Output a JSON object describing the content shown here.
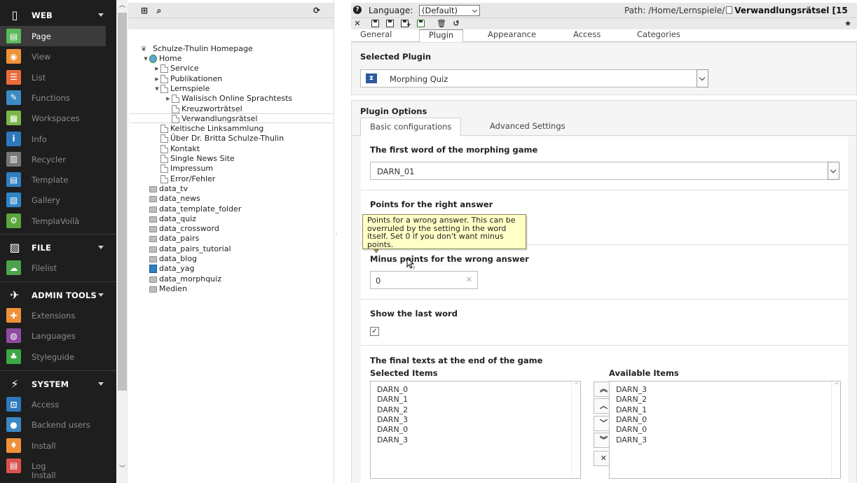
{
  "modules": {
    "groups": [
      {
        "key": "web",
        "label": "WEB",
        "icon": "page-icon"
      },
      {
        "key": "file",
        "label": "FILE",
        "icon": "image-icon"
      },
      {
        "key": "admin",
        "label": "ADMIN TOOLS",
        "icon": "rocket-icon"
      },
      {
        "key": "system",
        "label": "SYSTEM",
        "icon": "plug-icon"
      }
    ],
    "web_items": [
      {
        "label": "Page",
        "color": "#5cb85c",
        "active": true,
        "glyph": "▤"
      },
      {
        "label": "View",
        "color": "#f0913a",
        "glyph": "◉"
      },
      {
        "label": "List",
        "color": "#e96d3c",
        "glyph": "☰"
      },
      {
        "label": "Functions",
        "color": "#3c8bc4",
        "glyph": "✎"
      },
      {
        "label": "Workspaces",
        "color": "#7ab648",
        "glyph": "▦"
      },
      {
        "label": "Info",
        "color": "#2e78be",
        "glyph": "i"
      },
      {
        "label": "Recycler",
        "color": "#777777",
        "glyph": "▥"
      },
      {
        "label": "Template",
        "color": "#2f7fc1",
        "glyph": "▤"
      },
      {
        "label": "Gallery",
        "color": "#2f86c7",
        "glyph": "▧"
      },
      {
        "label": "TemplaVoilà",
        "color": "#5aa53c",
        "glyph": "⚙"
      }
    ],
    "file_items": [
      {
        "label": "Filelist",
        "color": "#4aa34a",
        "glyph": "☁"
      }
    ],
    "admin_items": [
      {
        "label": "Extensions",
        "color": "#f0913a",
        "glyph": "✚"
      },
      {
        "label": "Languages",
        "color": "#8e4ba1",
        "glyph": "◍"
      },
      {
        "label": "Styleguide",
        "color": "#3ea845",
        "glyph": "♣"
      }
    ],
    "system_items": [
      {
        "label": "Access",
        "color": "#2e78be",
        "glyph": "⊡"
      },
      {
        "label": "Backend users",
        "color": "#3c87c4",
        "glyph": "●"
      },
      {
        "label": "Install",
        "color": "#f0913a",
        "glyph": "♦"
      },
      {
        "label": "Log",
        "color": "#d9534f",
        "glyph": "▤"
      }
    ],
    "trailing_partial": "Install"
  },
  "tree": {
    "root": "Schulze-Thulin Homepage",
    "nodes": [
      {
        "label": "Home",
        "indent": 0,
        "icon": "globe",
        "exp": "▼"
      },
      {
        "label": "Service",
        "indent": 1,
        "icon": "page",
        "exp": "▶"
      },
      {
        "label": "Publikationen",
        "indent": 1,
        "icon": "page",
        "exp": "▶"
      },
      {
        "label": "Lernspiele",
        "indent": 1,
        "icon": "page",
        "exp": "▼"
      },
      {
        "label": "Walisisch Online Sprachtests",
        "indent": 2,
        "icon": "page",
        "exp": "▶"
      },
      {
        "label": "Kreuzworträtsel",
        "indent": 2,
        "icon": "page",
        "exp": ""
      },
      {
        "label": "Verwandlungsrätsel",
        "indent": 2,
        "icon": "page",
        "exp": ""
      },
      {
        "label": "Keltische Linksammlung",
        "indent": 1,
        "icon": "page",
        "exp": ""
      },
      {
        "label": "Über Dr. Britta Schulze-Thulin",
        "indent": 1,
        "icon": "page",
        "exp": ""
      },
      {
        "label": "Kontakt",
        "indent": 1,
        "icon": "page",
        "exp": ""
      },
      {
        "label": "Single News Site",
        "indent": 1,
        "icon": "page",
        "exp": ""
      },
      {
        "label": "Impressum",
        "indent": 1,
        "icon": "page",
        "exp": ""
      },
      {
        "label": "Error/Fehler",
        "indent": 1,
        "icon": "page",
        "exp": ""
      },
      {
        "label": "data_tv",
        "indent": 0,
        "icon": "folder",
        "exp": ""
      },
      {
        "label": "data_news",
        "indent": 0,
        "icon": "folder",
        "exp": ""
      },
      {
        "label": "data_template_folder",
        "indent": 0,
        "icon": "folder",
        "exp": ""
      },
      {
        "label": "data_quiz",
        "indent": 0,
        "icon": "folder",
        "exp": ""
      },
      {
        "label": "data_crossword",
        "indent": 0,
        "icon": "folder",
        "exp": ""
      },
      {
        "label": "data_pairs",
        "indent": 0,
        "icon": "folder",
        "exp": ""
      },
      {
        "label": "data_pairs_tutorial",
        "indent": 0,
        "icon": "folder",
        "exp": ""
      },
      {
        "label": "data_blog",
        "indent": 0,
        "icon": "folder",
        "exp": ""
      },
      {
        "label": "data_yag",
        "indent": 0,
        "icon": "sysfolder",
        "exp": ""
      },
      {
        "label": "data_morphquiz",
        "indent": 0,
        "icon": "folder",
        "exp": ""
      },
      {
        "label": "Medien",
        "indent": 0,
        "icon": "folder",
        "exp": ""
      }
    ]
  },
  "header": {
    "language_label": "Language:",
    "language_value": "(Default)",
    "path_prefix": "Path: /Home/Lernspiele/",
    "path_current": "Verwandlungsrätsel [15"
  },
  "tabs": [
    "General",
    "Plugin",
    "Appearance",
    "Access",
    "Categories"
  ],
  "plugin": {
    "selected_heading": "Selected Plugin",
    "selected_value": "Morphing Quiz",
    "options_heading": "Plugin Options",
    "subtabs": [
      "Basic configurations",
      "Advanced Settings"
    ]
  },
  "fields": {
    "first_word_label": "The first word of the morphing game",
    "first_word_value": "DARN_01",
    "right_points_label": "Points for the right answer",
    "minus_points_label": "Minus points for the wrong answer",
    "minus_points_value": "0",
    "show_last_label": "Show the last word",
    "show_last_checked": "✓",
    "final_texts_label": "The final texts at the end of the game",
    "selected_items_label": "Selected Items",
    "available_items_label": "Available Items",
    "selected_items": [
      "DARN_0",
      "DARN_1",
      "DARN_2",
      "DARN_3",
      "DARN_0",
      "DARN_3"
    ],
    "available_items": [
      "DARN_3",
      "DARN_2",
      "DARN_1",
      "DARN_0",
      "DARN_0",
      "DARN_3"
    ]
  },
  "tooltip": "Points for a wrong answer. This can be overruled by the setting in the word itself. Set 0 if you don't want minus points."
}
